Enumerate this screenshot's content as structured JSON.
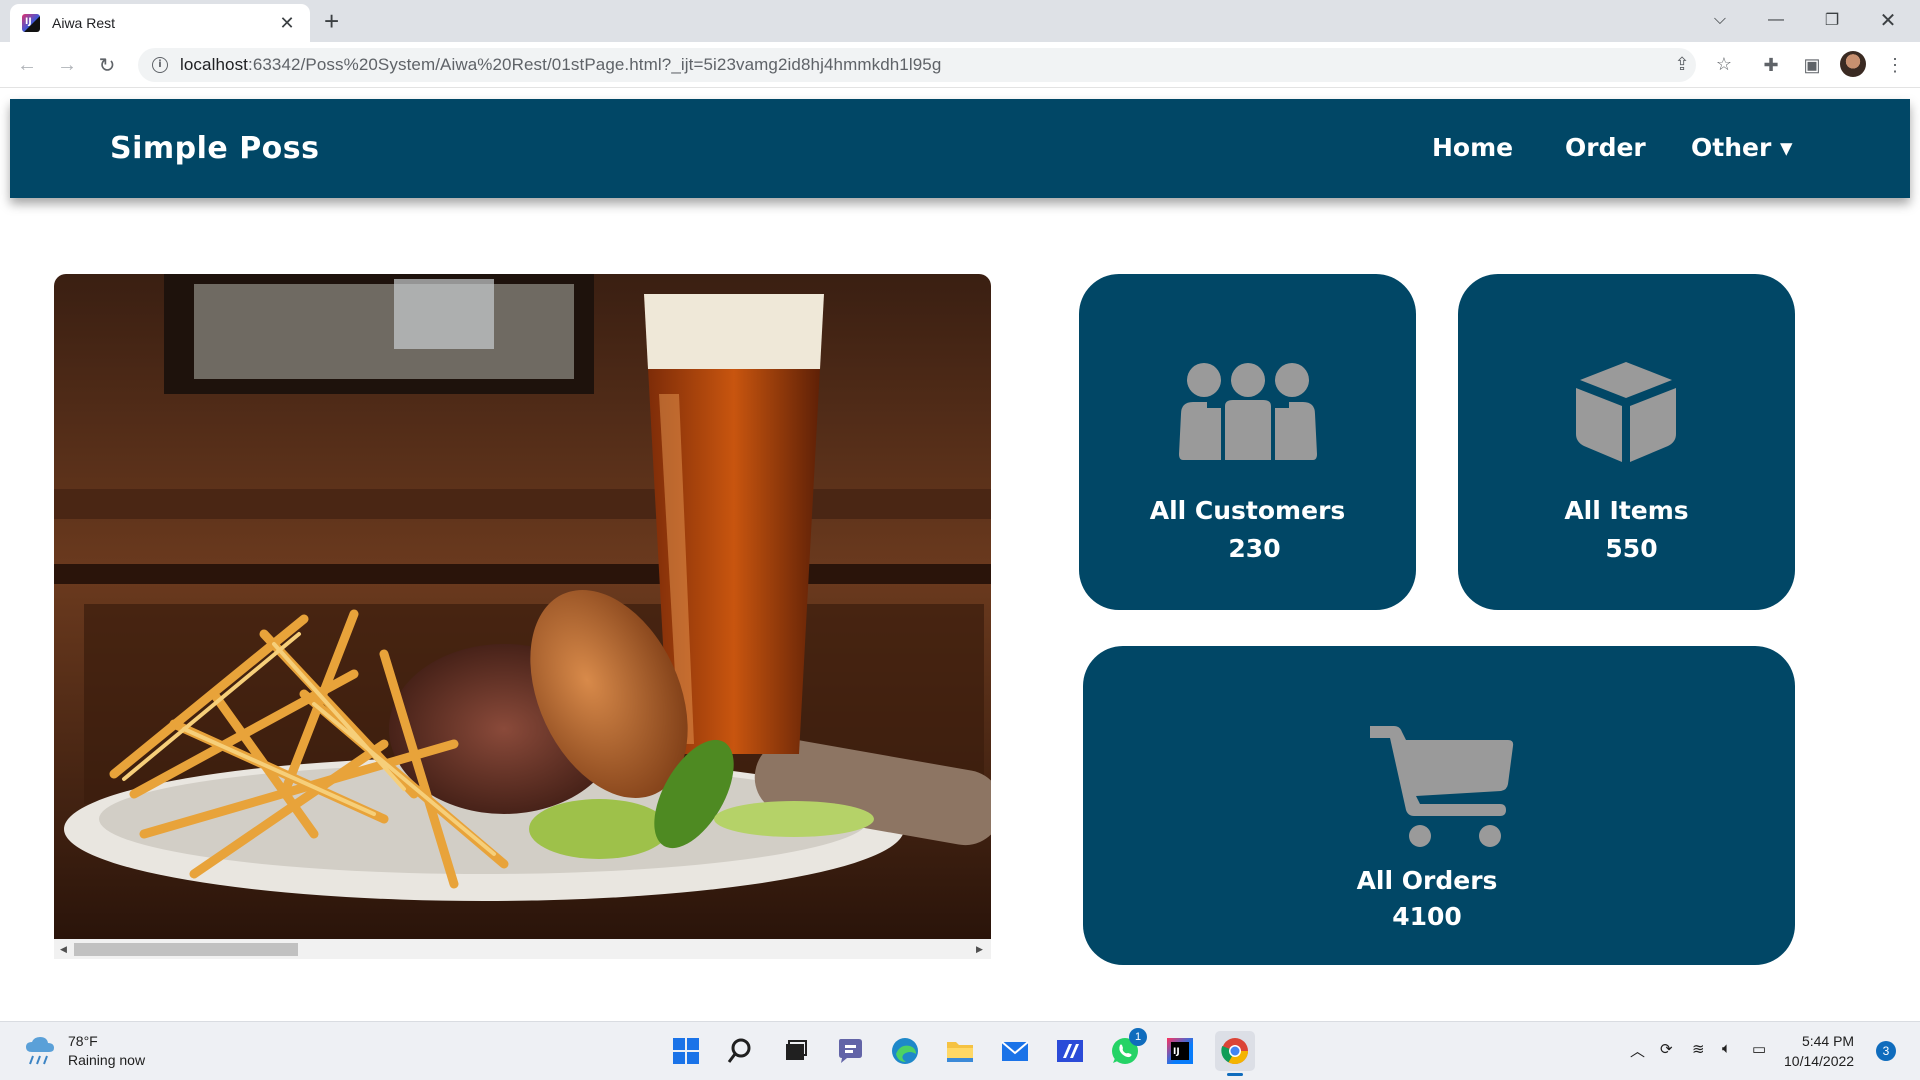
{
  "browser": {
    "tab_title": "Aiwa Rest",
    "url_host": "localhost",
    "url_rest": ":63342/Poss%20System/Aiwa%20Rest/01stPage.html?_ijt=5i23vamg2id8hj4hmmkdh1l95g"
  },
  "navbar": {
    "brand": "Simple Poss",
    "links": [
      "Home",
      "Order",
      "Other ▾"
    ]
  },
  "cards": {
    "customers": {
      "label": "All Customers",
      "value": "230"
    },
    "items": {
      "label": "All Items",
      "value": "550"
    },
    "orders": {
      "label": "All Orders",
      "value": "4100"
    }
  },
  "taskbar": {
    "weather_temp": "78°F",
    "weather_desc": "Raining now",
    "time": "5:44 PM",
    "date": "10/14/2022",
    "notifications": "3",
    "whatsapp_badge": "1"
  },
  "colors": {
    "brand": "#014766",
    "icon_gray": "#9a9a9a"
  }
}
